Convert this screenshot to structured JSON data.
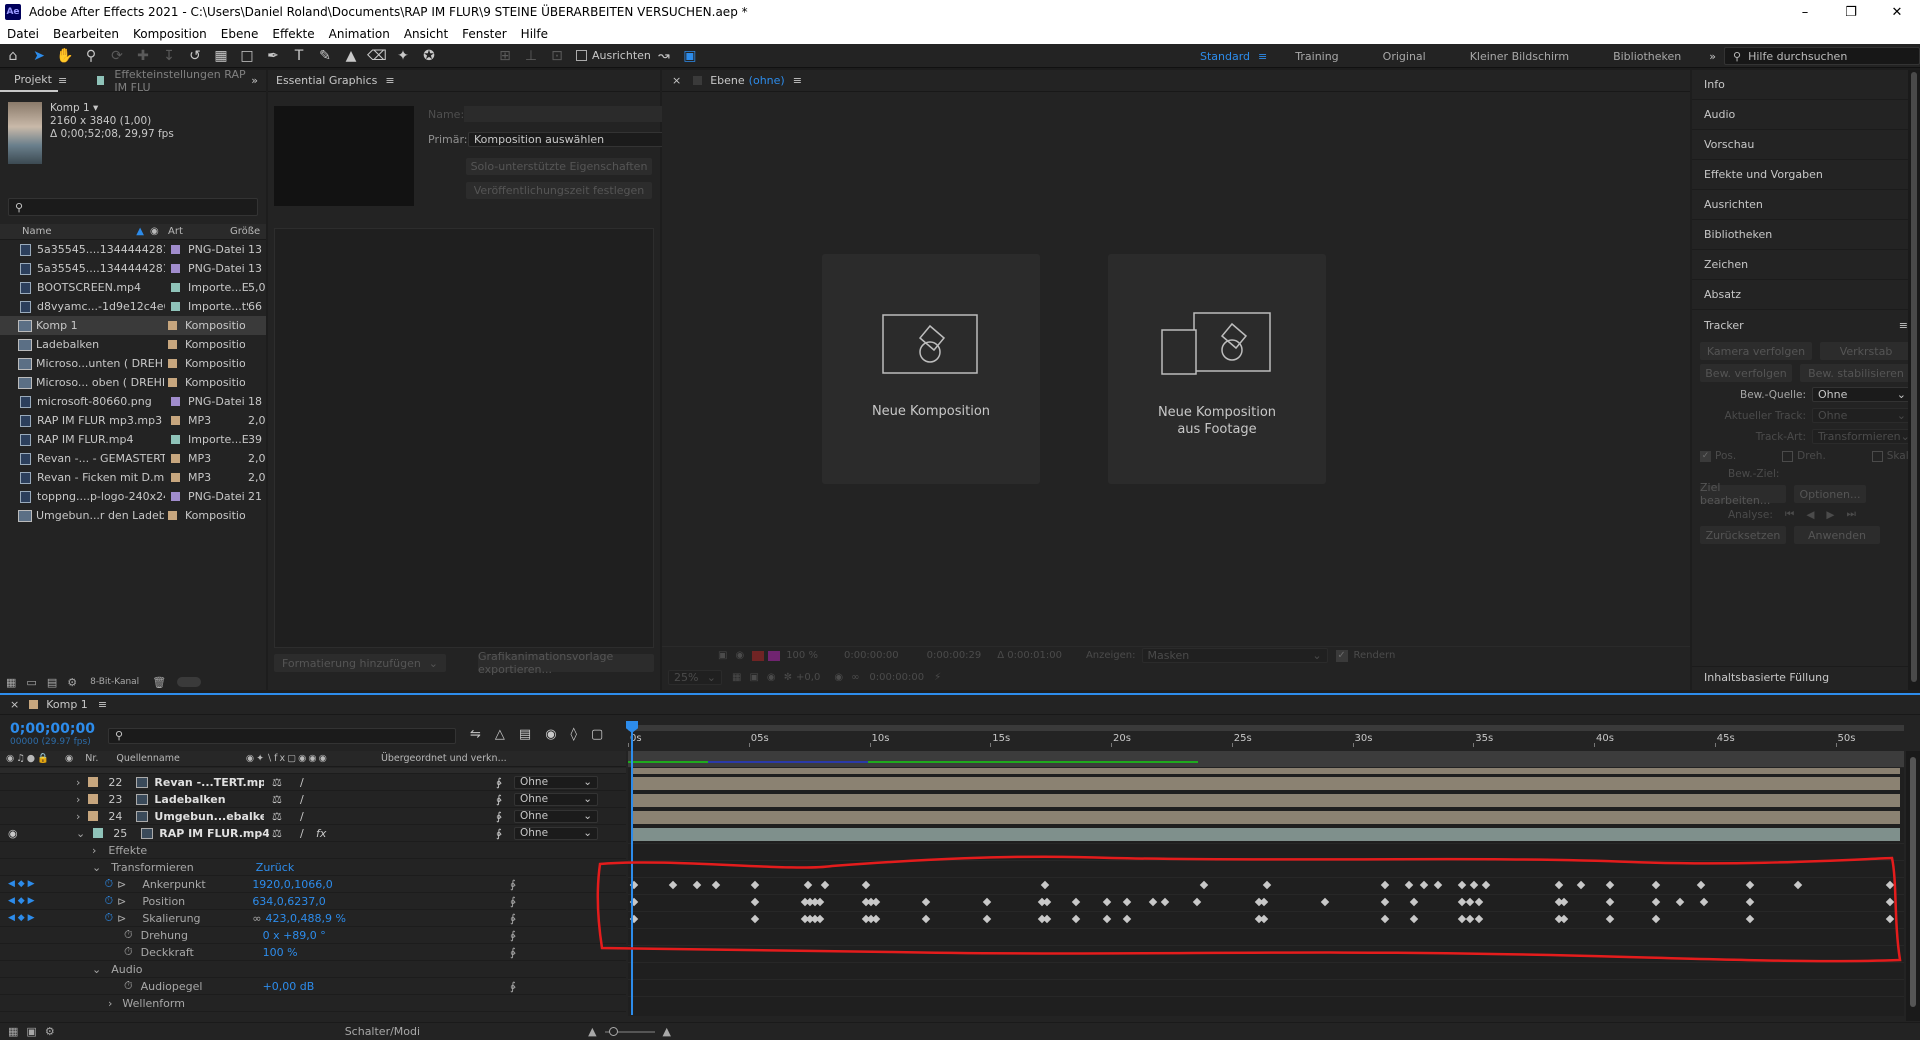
{
  "window": {
    "title": "Adobe After Effects 2021 - C:\\Users\\Daniel Roland\\Documents\\RAP IM FLUR\\9 STEINE ÜBERARBEITEN VERSUCHEN.aep *",
    "app_icon": "Ae"
  },
  "menu": [
    "Datei",
    "Bearbeiten",
    "Komposition",
    "Ebene",
    "Effekte",
    "Animation",
    "Ansicht",
    "Fenster",
    "Hilfe"
  ],
  "toolbar": {
    "align_label": "Ausrichten",
    "workspaces": [
      "Standard",
      "Training",
      "Original",
      "Kleiner Bildschirm",
      "Bibliotheken"
    ],
    "active_workspace": "Standard",
    "search_placeholder": "Hilfe durchsuchen"
  },
  "project": {
    "tab": "Projekt",
    "tab2": "Effekteinstellungen RAP IM FLU",
    "comp_name": "Komp 1 ▾",
    "comp_size": "2160 x 3840 (1,00)",
    "comp_duration": "Δ 0;00;52;08, 29,97 fps",
    "col_name": "Name",
    "col_type": "Art",
    "col_size": "Größe",
    "bit_depth": "8-Bit-Kanal",
    "items": [
      {
        "name": "5a35545....134444428166.png",
        "type": "PNG-Datei",
        "size": "13",
        "color": "#a08ccc",
        "kind": "file"
      },
      {
        "name": "5a35545....134444428166.png",
        "type": "PNG-Datei",
        "size": "13",
        "color": "#a08ccc",
        "kind": "file"
      },
      {
        "name": "BOOTSCREEN.mp4",
        "type": "Importe...EX",
        "size": "5,0",
        "color": "#8fc3b9",
        "kind": "file"
      },
      {
        "name": "d8vyamc...-1d9e12c4e67a.gif",
        "type": "Importe...tStill",
        "size": "66",
        "color": "#8fc3b9",
        "kind": "file"
      },
      {
        "name": "Komp 1",
        "type": "Komposition",
        "size": "",
        "color": "#c7a67e",
        "kind": "comp",
        "selected": true
      },
      {
        "name": "Ladebalken",
        "type": "Komposition",
        "size": "",
        "color": "#c7a67e",
        "kind": "comp"
      },
      {
        "name": "Microso...unten ( DREHEND )",
        "type": "Komposition",
        "size": "",
        "color": "#c7a67e",
        "kind": "comp"
      },
      {
        "name": "Microso... oben ( DREHEND )",
        "type": "Komposition",
        "size": "",
        "color": "#c7a67e",
        "kind": "comp"
      },
      {
        "name": "microsoft-80660.png",
        "type": "PNG-Datei",
        "size": "18",
        "color": "#a08ccc",
        "kind": "file"
      },
      {
        "name": "RAP IM FLUR mp3.mp3",
        "type": "MP3",
        "size": "2,0",
        "color": "#c7a67e",
        "kind": "file"
      },
      {
        "name": "RAP IM FLUR.mp4",
        "type": "Importe...EX",
        "size": "39",
        "color": "#8fc3b9",
        "kind": "file"
      },
      {
        "name": "Revan -... - GEMASTERT.mp3",
        "type": "MP3",
        "size": "2,0",
        "color": "#c7a67e",
        "kind": "file"
      },
      {
        "name": "Revan - Ficken mit D.mp3",
        "type": "MP3",
        "size": "2,0",
        "color": "#c7a67e",
        "kind": "file"
      },
      {
        "name": "toppng....p-logo-240x240.png",
        "type": "PNG-Datei",
        "size": "21",
        "color": "#a08ccc",
        "kind": "file"
      },
      {
        "name": "Umgebun...r den Ladebalken",
        "type": "Komposition",
        "size": "",
        "color": "#c7a67e",
        "kind": "comp"
      }
    ]
  },
  "essential_graphics": {
    "tab": "Essential Graphics",
    "name_label": "Name:",
    "primary_label": "Primär:",
    "primary_value": "Komposition auswählen",
    "btn_solo": "Solo-unterstützte Eigenschaften",
    "btn_publish": "Veröffentlichungszeit festlegen",
    "btn_format": "Formatierung hinzufügen",
    "btn_export": "Grafikanimationsvorlage exportieren..."
  },
  "layer_viewer": {
    "tab": "Ebene",
    "tab_suffix": "(ohne)",
    "new_comp": "Neue Komposition",
    "new_comp_footage_1": "Neue Komposition",
    "new_comp_footage_2": "aus Footage",
    "zoom": "100 %",
    "zoom2": "25%",
    "t1": "0:00:00:00",
    "t2": "0:00:00:29",
    "t3": "Δ 0:00:01:00",
    "show_label": "Anzeigen:",
    "show_value": "Masken",
    "render_label": "Rendern",
    "exposure": "+0,0",
    "t4": "0:00:00:00"
  },
  "right_panel": {
    "items": [
      "Info",
      "Audio",
      "Vorschau",
      "Effekte und Vorgaben",
      "Ausrichten",
      "Bibliotheken",
      "Zeichen",
      "Absatz"
    ],
    "tracker": {
      "title": "Tracker",
      "btn1": "Kamera verfolgen",
      "btn2": "Verkrstab",
      "btn3": "Bew. verfolgen",
      "btn4": "Bew. stabilisieren",
      "source_label": "Bew.-Quelle:",
      "source_value": "Ohne",
      "current_track_label": "Aktueller Track:",
      "current_track_value": "Ohne",
      "track_type_label": "Track-Art:",
      "track_type_value": "Transformieren",
      "cb_pos": "Pos.",
      "cb_rot": "Dreh.",
      "cb_scale": "Skal.",
      "target_label": "Bew.-Ziel:",
      "btn_edit_target": "Ziel bearbeiten...",
      "btn_options": "Optionen...",
      "analyze_label": "Analyse:",
      "btn_reset": "Zurücksetzen",
      "btn_apply": "Anwenden"
    },
    "content_aware": "Inhaltsbasierte Füllung"
  },
  "timeline": {
    "tab": "Komp 1",
    "timecode": "0;00;00;00",
    "timecode_sub": "00000 (29.97 fps)",
    "col_nr": "Nr.",
    "col_source": "Quellenname",
    "col_parent": "Übergeordnet und verkn...",
    "ruler": [
      "0s",
      "05s",
      "10s",
      "15s",
      "20s",
      "25s",
      "30s",
      "35s",
      "40s",
      "45s",
      "50s"
    ],
    "layers": [
      {
        "nr": "22",
        "name": "Revan -...TERT.mp3",
        "parent": "Ohne",
        "color": "#c7a67e"
      },
      {
        "nr": "23",
        "name": "Ladebalken",
        "parent": "Ohne",
        "color": "#c7a67e"
      },
      {
        "nr": "24",
        "name": "Umgebun...ebalken",
        "parent": "Ohne",
        "color": "#c7a67e"
      },
      {
        "nr": "25",
        "name": "RAP IM FLUR.mp4",
        "parent": "Ohne",
        "color": "#8fc3b9"
      }
    ],
    "props": {
      "effects": "Effekte",
      "transform": "Transformieren",
      "reset": "Zurück",
      "anchor_label": "Ankerpunkt",
      "anchor_value": "1920,0,1066,0",
      "position_label": "Position",
      "position_value": "634,0,6237,0",
      "scale_label": "Skalierung",
      "scale_value": "423,0,488,9 %",
      "rotation_label": "Drehung",
      "rotation_value": "0 x +89,0 °",
      "opacity_label": "Deckkraft",
      "opacity_value": "100 %",
      "audio": "Audio",
      "audio_level_label": "Audiopegel",
      "audio_level_value": "+0,00 dB",
      "waveform": "Wellenform"
    },
    "footer_label": "Schalter/Modi",
    "keyframe_rows": {
      "anchor": [
        0,
        1.6,
        2.6,
        3.4,
        5.0,
        7.2,
        7.9,
        9.6,
        17.0,
        23.6,
        26.2,
        31.1,
        32.1,
        32.7,
        33.3,
        34.3,
        34.8,
        35.3,
        38.3,
        39.2,
        40.4,
        42.3,
        44.2,
        46.2,
        48.2,
        52.0
      ],
      "position": [
        0,
        5.0,
        7.1,
        7.3,
        7.5,
        7.7,
        9.6,
        9.8,
        10.0,
        12.1,
        14.6,
        16.9,
        17.1,
        18.3,
        19.6,
        20.4,
        21.5,
        22.0,
        23.3,
        25.9,
        26.1,
        28.6,
        31.1,
        32.3,
        34.3,
        34.6,
        35.0,
        38.3,
        38.5,
        40.4,
        42.3,
        43.3,
        44.3,
        46.2,
        52.0
      ],
      "scale": [
        0,
        5.0,
        7.1,
        7.3,
        7.5,
        7.7,
        9.6,
        9.8,
        10.0,
        12.1,
        14.6,
        16.9,
        17.1,
        18.3,
        19.6,
        20.4,
        25.9,
        26.1,
        31.1,
        32.3,
        34.3,
        34.6,
        35.0,
        38.3,
        38.5,
        40.4,
        42.3,
        46.2,
        52.0
      ]
    }
  }
}
